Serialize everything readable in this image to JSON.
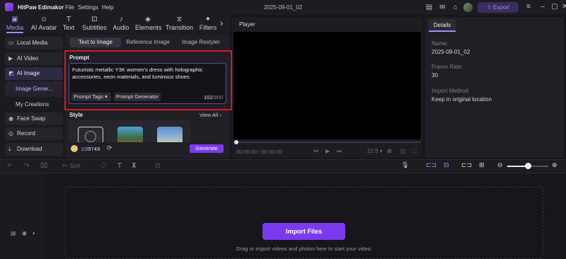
{
  "titlebar": {
    "app_title": "HitPaw Edimakor",
    "menus": [
      "File",
      "Settings",
      "Help"
    ],
    "doc_title": "2025-09-01_02",
    "export_label": "Export"
  },
  "toolbar": {
    "tools": [
      {
        "label": "Media",
        "icon": "media-icon"
      },
      {
        "label": "AI Avatar",
        "icon": "ai-avatar-icon"
      },
      {
        "label": "Text",
        "icon": "text-icon"
      },
      {
        "label": "Subtitles",
        "icon": "subtitles-icon"
      },
      {
        "label": "Audio",
        "icon": "audio-icon"
      },
      {
        "label": "Elements",
        "icon": "elements-icon"
      },
      {
        "label": "Transition",
        "icon": "transition-icon"
      },
      {
        "label": "Filters",
        "icon": "filters-icon"
      }
    ]
  },
  "sidebar": {
    "items": [
      {
        "label": "Local Media",
        "icon": "folder-icon"
      },
      {
        "label": "AI Video",
        "icon": "ai-video-icon"
      },
      {
        "label": "AI Image",
        "icon": "ai-image-icon"
      },
      {
        "label": "Image Gener...",
        "icon": ""
      },
      {
        "label": "My Creations",
        "icon": ""
      },
      {
        "label": "Face Swap",
        "icon": "face-swap-icon"
      },
      {
        "label": "Record",
        "icon": "record-icon"
      },
      {
        "label": "Download",
        "icon": "download-icon"
      }
    ]
  },
  "panel": {
    "tabs": [
      "Text to Image",
      "Reference Image",
      "Image Restyler"
    ],
    "prompt_title": "Prompt",
    "prompt_text": "Futuristic metallic Y3K women’s dress with holographic accessories, neon materials, and luminous shoes",
    "prompt_tags_label": "Prompt Tags",
    "prompt_generator_label": "Prompt Generator",
    "char_count": "102",
    "char_max": "/800",
    "style_title": "Style",
    "view_all_label": "View All",
    "credits_used": "10",
    "credits_total": "/9749",
    "generate_label": "Generate"
  },
  "player": {
    "title": "Player",
    "timecode": "00:00:00 / 00:00:00",
    "ratio": "21:9"
  },
  "details": {
    "tab": "Details",
    "name_label": "Name:",
    "name_value": "2025-09-01_02",
    "frame_rate_label": "Frame Rate:",
    "frame_rate_value": "30",
    "import_method_label": "Import Method:",
    "import_method_value": "Keep in original location"
  },
  "timeline": {
    "split_label": "Split",
    "import_label": "Import Files",
    "drop_hint": "Drag or import videos and photos here to start your video.",
    "zoom_level": 0.5
  },
  "colors": {
    "accent": "#7c3aed",
    "highlight_border": "#d11d1d",
    "background": "#16161b"
  }
}
